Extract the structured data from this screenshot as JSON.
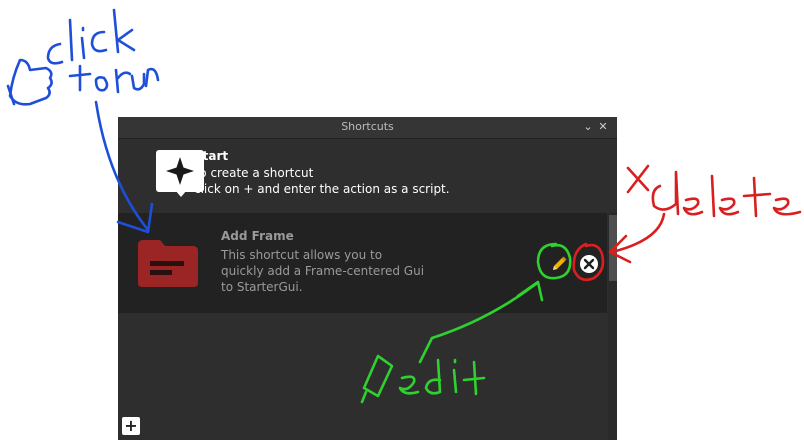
{
  "window": {
    "title": "Shortcuts",
    "minimize_glyph": "⌄",
    "close_glyph": "✕"
  },
  "start": {
    "title": "Start",
    "line1": "To create a shortcut",
    "line2": "click on + and enter the action as a script."
  },
  "shortcut": {
    "title": "Add Frame",
    "line1": "This shortcut allows you to",
    "line2": "quickly add a Frame-centered Gui",
    "line3": "to StarterGui."
  },
  "footer": {
    "add_glyph": "+"
  },
  "colors": {
    "panel_bg": "#2e2e2e",
    "card_bg": "#222222",
    "folder_red": "#9b2424",
    "annotation_blue": "#1f4fd8",
    "annotation_green": "#2fd12f",
    "annotation_red": "#d82020"
  },
  "icons": [
    "sparkle-icon",
    "folder-icon",
    "pencil-icon",
    "close-circle-icon",
    "plus-icon"
  ]
}
